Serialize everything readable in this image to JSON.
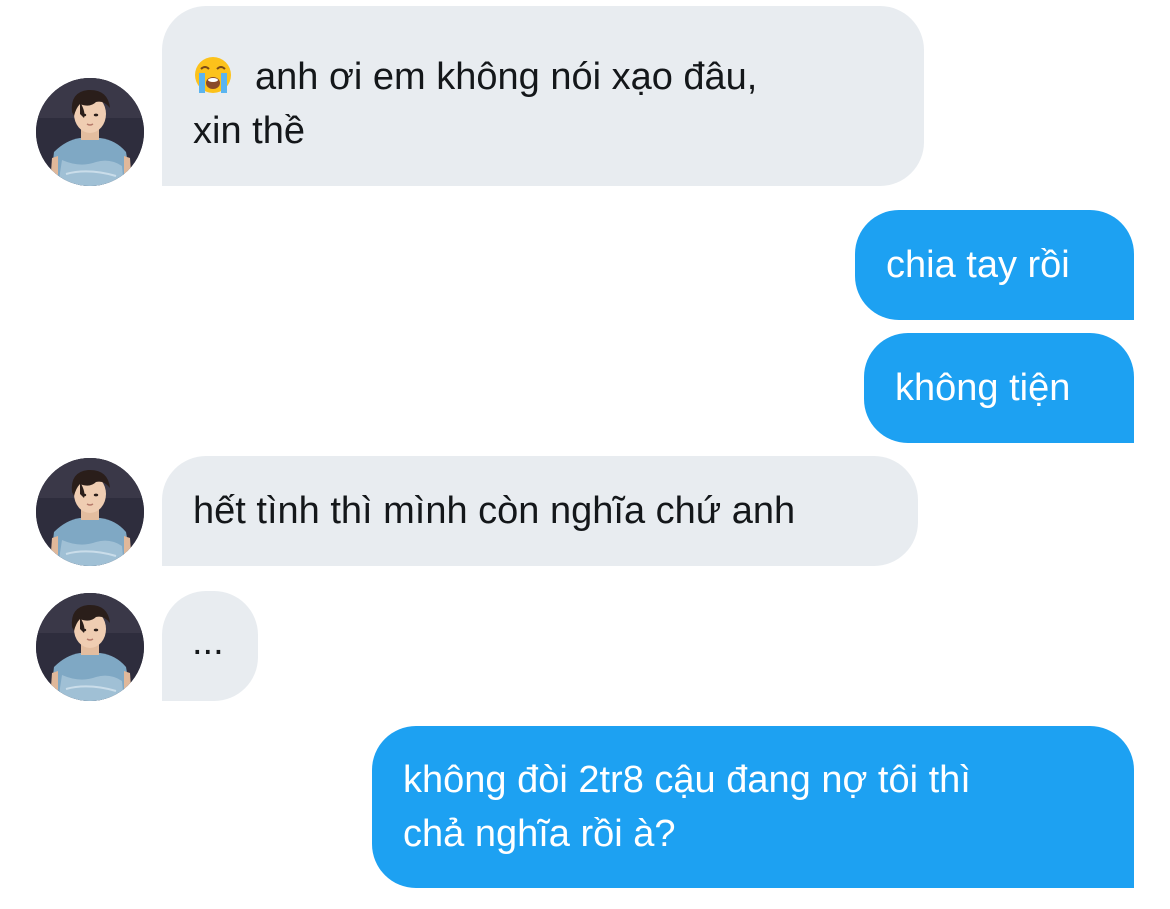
{
  "conversation": {
    "messages": [
      {
        "sender": "other",
        "emoji": "loudly-crying-face",
        "line1": "anh ơi em không nói xạo đâu,",
        "line2": "xin thề"
      },
      {
        "sender": "me",
        "text": "chia tay rồi"
      },
      {
        "sender": "me",
        "text": "không tiện"
      },
      {
        "sender": "other",
        "text": "hết tình thì mình còn nghĩa chứ anh"
      },
      {
        "sender": "other",
        "text": "..."
      },
      {
        "sender": "me",
        "line1": "không đòi 2tr8 cậu đang nợ tôi thì",
        "line2": "chả nghĩa rồi à?"
      }
    ]
  },
  "colors": {
    "incoming_bubble": "#e8ecf0",
    "outgoing_bubble": "#1da1f2",
    "incoming_text": "#14171a",
    "outgoing_text": "#ffffff"
  },
  "icons": {
    "avatar": "profile-photo-avatar",
    "emoji": "loudly-crying-face-emoji"
  }
}
